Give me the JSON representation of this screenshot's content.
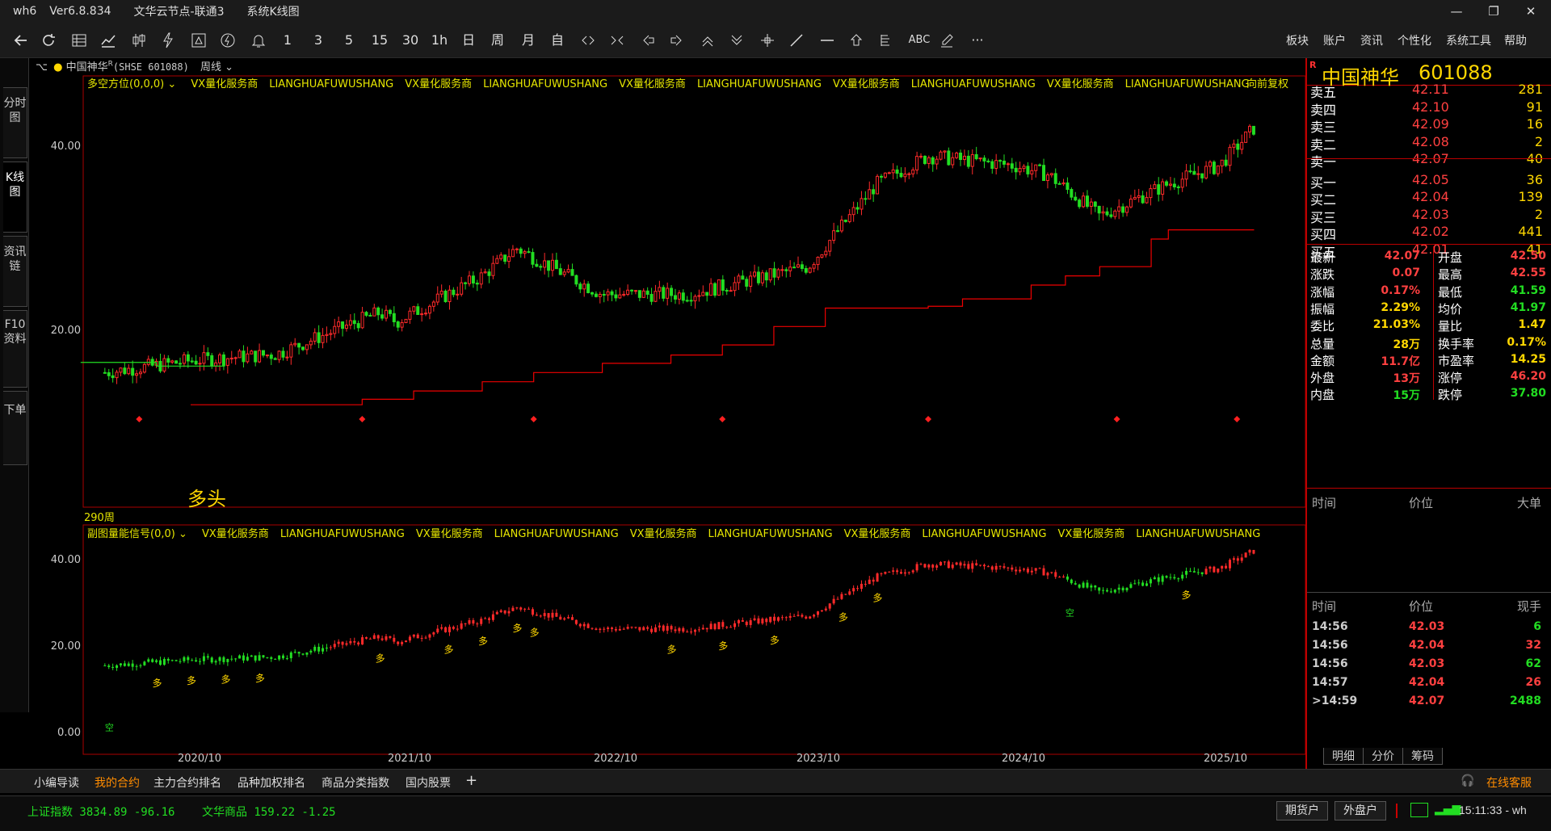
{
  "titlebar": {
    "app": "wh6",
    "version": "Ver6.8.834",
    "server": "文华云节点-联通3",
    "view": "系统K线图",
    "min": "—",
    "max": "❐",
    "close": "✕"
  },
  "toolbar": {
    "period_labels": [
      "1",
      "3",
      "5",
      "15",
      "30",
      "1h",
      "日",
      "周",
      "月",
      "自"
    ],
    "text_tool": "ABC",
    "more": "···",
    "menus": [
      "板块",
      "账户",
      "资讯",
      "个性化",
      "系统工具",
      "帮助"
    ]
  },
  "left_tabs": [
    "分时图",
    "K线图",
    "资讯链",
    "F10资料",
    "下单"
  ],
  "info": {
    "name": "中国神华",
    "superscript": "R",
    "exchange_code": "(SHSE 601088)",
    "period": "周线"
  },
  "main_chart": {
    "indicator": "多空方位(0,0,0)",
    "watermark": [
      "VX量化服务商",
      "LIANGHUAFUWUSHANG",
      "VX量化服务商",
      "LIANGHUAFUWUSHANG",
      "VX量化服务商",
      "LIANGHUAFUWUSHANG",
      "VX量化服务商",
      "LIANGHUAFUWUSHANG",
      "VX量化服务商",
      "LIANGHUAFUWUSHANG"
    ],
    "adjust": "向前复权",
    "y_ticks": [
      "40.00",
      "20.00"
    ],
    "signal_label": "多头",
    "bar_count": "290周"
  },
  "sub_chart": {
    "indicator": "副图量能信号(0,0)",
    "watermark": [
      "VX量化服务商",
      "LIANGHUAFUWUSHANG",
      "VX量化服务商",
      "LIANGHUAFUWUSHANG",
      "VX量化服务商",
      "LIANGHUAFUWUSHANG",
      "VX量化服务商",
      "LIANGHUAFUWUSHANG",
      "VX量化服务商",
      "LIANGHUAFUWUSHANG"
    ],
    "y_ticks": [
      "40.00",
      "20.00",
      "0.00"
    ],
    "buy_signal": "多",
    "sell_signal": "空"
  },
  "x_ticks": [
    "2020/10",
    "2021/10",
    "2022/10",
    "2023/10",
    "2024/10",
    "2025/10"
  ],
  "chart_data": {
    "type": "candlestick",
    "y_ticks": [
      40,
      20
    ],
    "x_ticks": [
      "2020/10",
      "2021/10",
      "2022/10",
      "2023/10",
      "2024/10",
      "2025/10"
    ],
    "approx_close_path": [
      {
        "date": "2020/05",
        "close": 15.5
      },
      {
        "date": "2020/10",
        "close": 16.8
      },
      {
        "date": "2021/03",
        "close": 17.5
      },
      {
        "date": "2021/09",
        "close": 22
      },
      {
        "date": "2021/10",
        "close": 21
      },
      {
        "date": "2022/03",
        "close": 26
      },
      {
        "date": "2022/05",
        "close": 29
      },
      {
        "date": "2022/10",
        "close": 24
      },
      {
        "date": "2023/03",
        "close": 24
      },
      {
        "date": "2023/10",
        "close": 27
      },
      {
        "date": "2024/02",
        "close": 36
      },
      {
        "date": "2024/05",
        "close": 39
      },
      {
        "date": "2024/10",
        "close": 38
      },
      {
        "date": "2024/12",
        "close": 37
      },
      {
        "date": "2025/03",
        "close": 32.5
      },
      {
        "date": "2025/07",
        "close": 36
      },
      {
        "date": "2025/10",
        "close": 38
      },
      {
        "date": "2025/12",
        "close": 42.07
      }
    ]
  },
  "stock": {
    "mark": "R",
    "name": "中国神华",
    "code": "601088"
  },
  "orderbook": {
    "asks": [
      {
        "label": "卖五",
        "price": "42.11",
        "vol": "281"
      },
      {
        "label": "卖四",
        "price": "42.10",
        "vol": "91"
      },
      {
        "label": "卖三",
        "price": "42.09",
        "vol": "16"
      },
      {
        "label": "卖二",
        "price": "42.08",
        "vol": "2"
      },
      {
        "label": "卖一",
        "price": "42.07",
        "vol": "40"
      }
    ],
    "bids": [
      {
        "label": "买一",
        "price": "42.05",
        "vol": "36"
      },
      {
        "label": "买二",
        "price": "42.04",
        "vol": "139"
      },
      {
        "label": "买三",
        "price": "42.03",
        "vol": "2"
      },
      {
        "label": "买四",
        "price": "42.02",
        "vol": "441"
      },
      {
        "label": "买五",
        "price": "42.01",
        "vol": "41"
      }
    ]
  },
  "stats": [
    {
      "l1": "最新",
      "v1": "42.07",
      "c1": "#ff4040",
      "l2": "开盘",
      "v2": "42.50",
      "c2": "#ff4040"
    },
    {
      "l1": "涨跌",
      "v1": "0.07",
      "c1": "#ff4040",
      "l2": "最高",
      "v2": "42.55",
      "c2": "#ff4040"
    },
    {
      "l1": "涨幅",
      "v1": "0.17%",
      "c1": "#ff4040",
      "l2": "最低",
      "v2": "41.59",
      "c2": "#22dd22"
    },
    {
      "l1": "振幅",
      "v1": "2.29%",
      "c1": "#ffd700",
      "l2": "均价",
      "v2": "41.97",
      "c2": "#22dd22"
    },
    {
      "l1": "委比",
      "v1": "21.03%",
      "c1": "#ffd700",
      "l2": "量比",
      "v2": "1.47",
      "c2": "#ffd700"
    },
    {
      "l1": "总量",
      "v1": "28万",
      "c1": "#ffd700",
      "l2": "换手率",
      "v2": "0.17%",
      "c2": "#ffd700"
    },
    {
      "l1": "金额",
      "v1": "11.7亿",
      "c1": "#ff4040",
      "l2": "市盈率",
      "v2": "14.25",
      "c2": "#ffd700"
    },
    {
      "l1": "外盘",
      "v1": "13万",
      "c1": "#ff4040",
      "l2": "涨停",
      "v2": "46.20",
      "c2": "#ff4040"
    },
    {
      "l1": "内盘",
      "v1": "15万",
      "c1": "#22dd22",
      "l2": "跌停",
      "v2": "37.80",
      "c2": "#22dd22"
    }
  ],
  "bigorder_header": {
    "c1": "时间",
    "c2": "价位",
    "c3": "大单"
  },
  "tick_header": {
    "c1": "时间",
    "c2": "价位",
    "c3": "现手"
  },
  "ticks": [
    {
      "time": "14:56",
      "price": "42.03",
      "vol": "6",
      "color": "#22dd22"
    },
    {
      "time": "14:56",
      "price": "42.04",
      "vol": "32",
      "color": "#ff4040"
    },
    {
      "time": "14:56",
      "price": "42.03",
      "vol": "62",
      "color": "#22dd22"
    },
    {
      "time": "14:57",
      "price": "42.04",
      "vol": "26",
      "color": "#ff4040"
    },
    {
      "time": ">14:59",
      "price": "42.07",
      "vol": "2488",
      "color": "#22dd22"
    }
  ],
  "right_tabs": [
    "明细",
    "分价",
    "筹码"
  ],
  "bottom_tabs": [
    "小编导读",
    "我的合约",
    "主力合约排名",
    "品种加权排名",
    "商品分类指数",
    "国内股票",
    "+"
  ],
  "service": "在线客服",
  "status": {
    "index1": "上证指数  3834.89  -96.16",
    "index2": "文华商品  159.22  -1.25",
    "btn1": "期货户",
    "btn2": "外盘户",
    "time": "15:11:33 - wh"
  }
}
